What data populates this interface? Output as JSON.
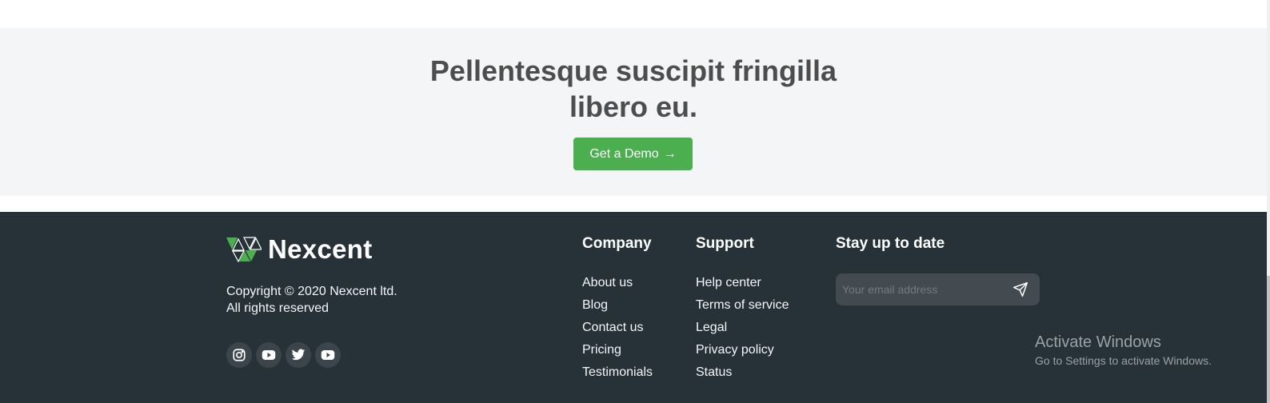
{
  "cta": {
    "title_line1": "Pellentesque suscipit fringilla",
    "title_line2": "libero eu.",
    "button_label": "Get a Demo",
    "button_arrow": "→",
    "background": "#f4f5f7",
    "button_color": "#4caf4f"
  },
  "footer": {
    "background": "#263238",
    "brand": "Nexcent",
    "brand_accent": "#4caf4f",
    "copyright_line1": "Copyright © 2020 Nexcent ltd.",
    "copyright_line2": "All rights reserved",
    "socials": [
      {
        "icon": "instagram-icon"
      },
      {
        "icon": "youtube-icon"
      },
      {
        "icon": "twitter-icon"
      },
      {
        "icon": "youtube-icon"
      }
    ],
    "company": {
      "title": "Company",
      "links": [
        "About us",
        "Blog",
        "Contact us",
        "Pricing",
        "Testimonials"
      ]
    },
    "support": {
      "title": "Support",
      "links": [
        "Help center",
        "Terms of service",
        "Legal",
        "Privacy policy",
        "Status"
      ]
    },
    "newsletter": {
      "title": "Stay up to date",
      "placeholder": "Your email address",
      "send_icon": "send-icon"
    }
  },
  "watermark": {
    "title": "Activate Windows",
    "subtitle": "Go to Settings to activate Windows."
  }
}
